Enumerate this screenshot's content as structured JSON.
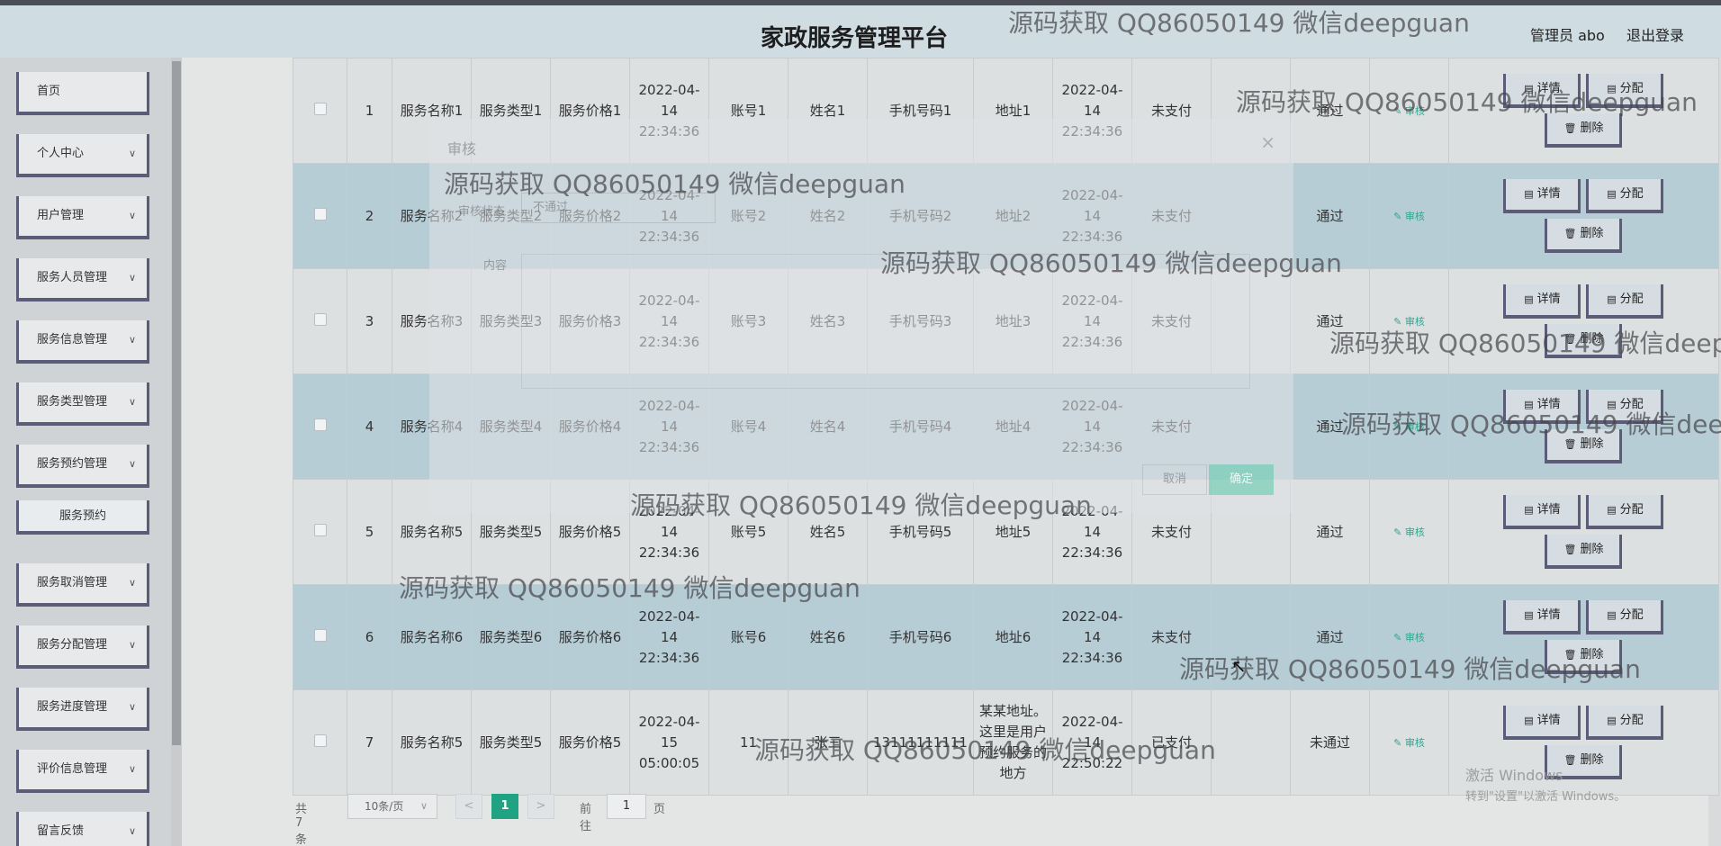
{
  "header": {
    "title": "家政服务管理平台",
    "user": "管理员 abo",
    "logout": "退出登录"
  },
  "sidebar": {
    "items": [
      {
        "label": "首页"
      },
      {
        "label": "个人中心"
      },
      {
        "label": "用户管理"
      },
      {
        "label": "服务人员管理"
      },
      {
        "label": "服务信息管理"
      },
      {
        "label": "服务类型管理"
      },
      {
        "label": "服务预约管理"
      },
      {
        "label": "服务预约"
      },
      {
        "label": "服务取消管理"
      },
      {
        "label": "服务分配管理"
      },
      {
        "label": "服务进度管理"
      },
      {
        "label": "评价信息管理"
      },
      {
        "label": "留言反馈"
      }
    ]
  },
  "table": {
    "actions": {
      "detail": "详情",
      "assign": "分配",
      "delete": "删除",
      "audit": "审核"
    },
    "rows": [
      {
        "idx": "1",
        "name": "服务名称1",
        "type": "服务类型1",
        "price": "服务价格1",
        "time": "2022-04-14 22:34:36",
        "account": "账号1",
        "person": "姓名1",
        "phone": "手机号码1",
        "addr": "地址1",
        "time2": "2022-04-14 22:34:36",
        "pay": "未支付",
        "status": "通过"
      },
      {
        "idx": "2",
        "name": "服务名称2",
        "type": "服务类型2",
        "price": "服务价格2",
        "time": "2022-04-14 22:34:36",
        "account": "账号2",
        "person": "姓名2",
        "phone": "手机号码2",
        "addr": "地址2",
        "time2": "2022-04-14 22:34:36",
        "pay": "未支付",
        "status": "通过"
      },
      {
        "idx": "3",
        "name": "服务名称3",
        "type": "服务类型3",
        "price": "服务价格3",
        "time": "2022-04-14 22:34:36",
        "account": "账号3",
        "person": "姓名3",
        "phone": "手机号码3",
        "addr": "地址3",
        "time2": "2022-04-14 22:34:36",
        "pay": "未支付",
        "status": "通过"
      },
      {
        "idx": "4",
        "name": "服务名称4",
        "type": "服务类型4",
        "price": "服务价格4",
        "time": "2022-04-14 22:34:36",
        "account": "账号4",
        "person": "姓名4",
        "phone": "手机号码4",
        "addr": "地址4",
        "time2": "2022-04-14 22:34:36",
        "pay": "未支付",
        "status": "通过"
      },
      {
        "idx": "5",
        "name": "服务名称5",
        "type": "服务类型5",
        "price": "服务价格5",
        "time": "2022-04-14 22:34:36",
        "account": "账号5",
        "person": "姓名5",
        "phone": "手机号码5",
        "addr": "地址5",
        "time2": "2022-04-14 22:34:36",
        "pay": "未支付",
        "status": "通过"
      },
      {
        "idx": "6",
        "name": "服务名称6",
        "type": "服务类型6",
        "price": "服务价格6",
        "time": "2022-04-14 22:34:36",
        "account": "账号6",
        "person": "姓名6",
        "phone": "手机号码6",
        "addr": "地址6",
        "time2": "2022-04-14 22:34:36",
        "pay": "未支付",
        "status": "通过"
      },
      {
        "idx": "7",
        "name": "服务名称5",
        "type": "服务类型5",
        "price": "服务价格5",
        "time": "2022-04-15 05:00:05",
        "account": "11",
        "person": "张三",
        "phone": "13111111111",
        "addr": "某某地址。这里是用户预约服务的地方",
        "time2": "2022-04-14 22:50:22",
        "pay": "已支付",
        "status": "未通过"
      }
    ]
  },
  "pager": {
    "total": "共 7 条",
    "size": "10条/页",
    "current": "1",
    "goto": "前往",
    "input": "1",
    "page": "页"
  },
  "modal": {
    "title": "审核",
    "status_label": "审核状态",
    "status_value": "不通过",
    "content_label": "内容",
    "cancel": "取消",
    "ok": "确定"
  },
  "watermark": "源码获取 QQ86050149 微信deepguan",
  "windows": {
    "line1": "激活 Windows",
    "line2": "转到\"设置\"以激活 Windows。"
  }
}
